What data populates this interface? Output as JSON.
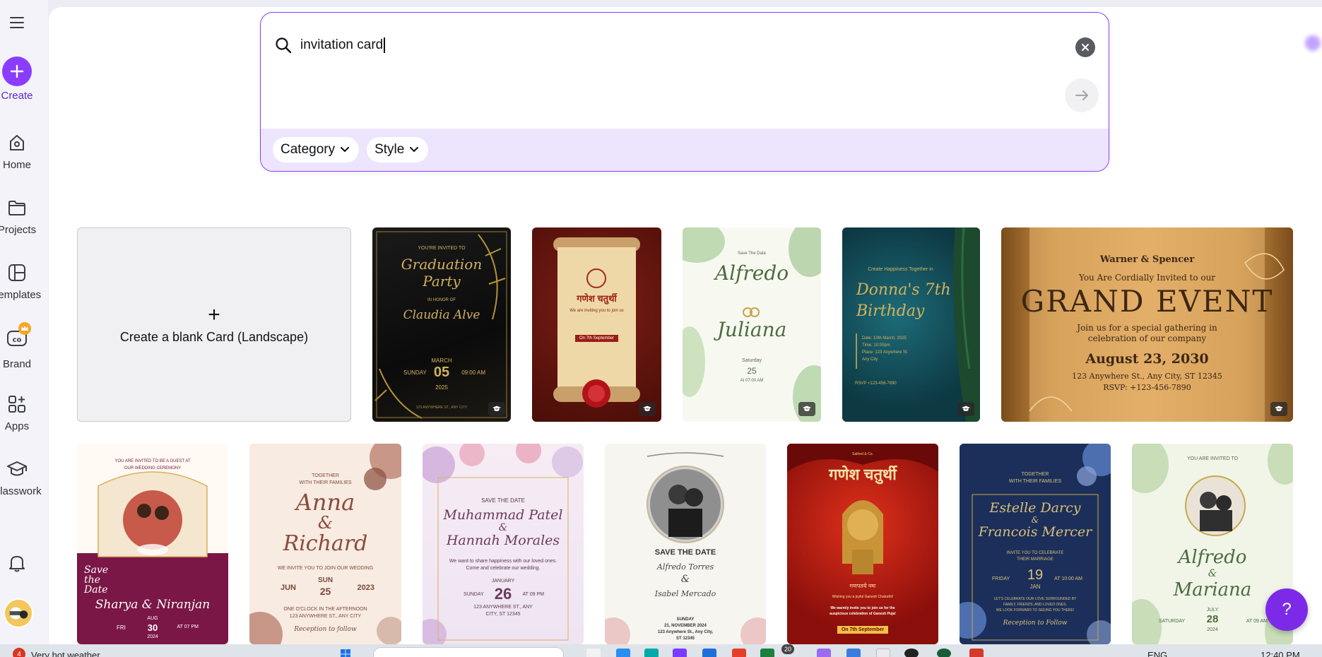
{
  "sidebar": {
    "create": "Create",
    "home": "Home",
    "projects": "Projects",
    "templates": "Templates",
    "brand": "Brand",
    "apps": "Apps",
    "classwork": "Classwork"
  },
  "search": {
    "query": "invitation card",
    "filters": [
      "Category",
      "Style"
    ]
  },
  "blank_card": {
    "plus": "+",
    "label": "Create a blank Card (Landscape)"
  },
  "cards_row1": [
    {
      "lines": [
        "YOU'RE INVITED TO",
        "Graduation",
        "Party",
        "IN HONOR OF",
        "Claudia Alve",
        "SUNDAY",
        "MARCH",
        "05",
        "2025",
        "09:00 AM",
        "123 ANYWHERE ST., ANY CITY"
      ]
    },
    {
      "lines": [
        "गणेश चतुर्थी",
        "We are inviting you to join us",
        "On 7th September"
      ]
    },
    {
      "lines": [
        "Save The Date",
        "Alfredo",
        "Juliana",
        "Saturday",
        "25",
        "At 07:00 AM"
      ]
    },
    {
      "lines": [
        "Create Happiness Together in",
        "Donna's 7th",
        "Birthday",
        "Date: 10th March, 2025",
        "Time: 10:00pm",
        "Place: 123 Anywhere St.",
        "Any City",
        "RSVP +123-456-7890"
      ]
    },
    {
      "lines": [
        "Warner & Spencer",
        "You Are Cordially Invited to our",
        "GRAND EVENT",
        "Join us for a special gathering in",
        "celebration of our company",
        "August 23, 2030",
        "123 Anywhere St., Any City, ST 12345",
        "RSVP: +123-456-7890"
      ]
    }
  ],
  "cards_row2": [
    {
      "lines": [
        "YOU ARE INVITED TO BE A GUEST AT",
        "OUR WEDDING CEREMONY",
        "Save the Date",
        "Sharya & Niranjan",
        "FRI",
        "30",
        "AT 07 PM",
        "AUG",
        "2024"
      ]
    },
    {
      "lines": [
        "TOGETHER",
        "WITH THEIR FAMILIES",
        "Anna",
        "&",
        "Richard",
        "WE INVITE YOU TO JOIN OUR WEDDING",
        "JUN",
        "SUN",
        "25",
        "2023",
        "ONE O'CLOCK IN THE AFTERNOON",
        "123 ANYWHERE ST., ANY CITY",
        "Reception to follow"
      ]
    },
    {
      "lines": [
        "SAVE THE DATE",
        "Muhammad Patel",
        "&",
        "Hannah Morales",
        "We want to share happiness with our loved ones.",
        "Come and celebrate our wedding.",
        "JANUARY",
        "SUNDAY",
        "26",
        "AT 09 PM",
        "123 ANYWHERE ST., ANY",
        "CITY, ST 12345"
      ]
    },
    {
      "lines": [
        "SAVE THE DATE",
        "Alfredo Torres",
        "&",
        "Isabel Mercado",
        "SUNDAY",
        "21, NOVEMBER 2024",
        "123 Anywhere St., Any City,",
        "ST 12345"
      ]
    },
    {
      "lines": [
        "Salford & Co.",
        "गणेश चतुर्थी",
        "गणपतये नमः",
        "Wishing you a joyful Ganesh Chaturthi!",
        "We warmly invite you to join us for the",
        "auspicious celebration of Ganesh Puja!",
        "On 7th September"
      ]
    },
    {
      "lines": [
        "TOGETHER",
        "WITH THEIR FAMILIES",
        "Estelle Darcy",
        "&",
        "Francois Mercer",
        "INVITE YOU TO CELEBRATE",
        "THEIR MARRIAGE",
        "FRIDAY",
        "19",
        "JAN",
        "AT 10:00 AM",
        "LET'S CELEBRATE OUR LOVE SURROUNDED BY",
        "FAMILY, FRIENDS, AND LOVED ONES.",
        "WE LOOK FORWARD TO SEEING YOU THERE!",
        "Reception to Follow"
      ]
    },
    {
      "lines": [
        "YOU ARE INVITED TO",
        "Alfredo",
        "&",
        "Mariana",
        "JULY",
        "SATURDAY",
        "28",
        "AT 09 AM",
        "2024"
      ]
    }
  ],
  "help": "?",
  "taskbar": {
    "weather": "Very hot weather",
    "weather_badge": "4",
    "badge_count": "20",
    "lang": "ENG",
    "time": "12:40 PM"
  }
}
